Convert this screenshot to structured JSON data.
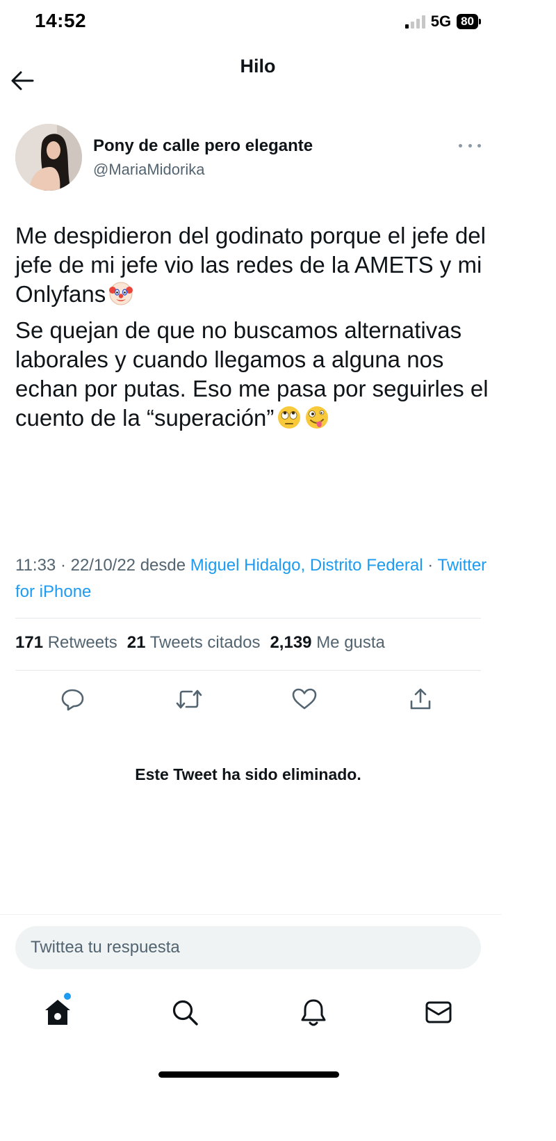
{
  "status_bar": {
    "time": "14:52",
    "network": "5G",
    "battery": "80"
  },
  "header": {
    "title": "Hilo",
    "back_icon": "arrow-left-icon"
  },
  "tweet": {
    "author_name": "Pony de calle pero elegante",
    "author_handle": "@MariaMidorika",
    "paragraph_1": "Me despidieron del godinato porque el jefe del jefe de mi jefe vio las redes de la AMETS y mi Onlyfans",
    "paragraph_1_emoji": "clown-face-emoji",
    "paragraph_2": "Se quejan de que no buscamos alternativas laborales y cuando llegamos a alguna nos echan por putas. Eso me pasa por seguirles el cuento de la “superación”",
    "paragraph_2_emojis": [
      "eye-roll-emoji",
      "zany-face-emoji"
    ],
    "time": "11:33",
    "date": "22/10/22",
    "from_label": "desde",
    "location": "Miguel Hidalgo, Distrito Federal",
    "source": "Twitter for iPhone",
    "retweets_count": "171",
    "retweets_label": "Retweets",
    "quotes_count": "21",
    "quotes_label": "Tweets citados",
    "likes_count": "2,139",
    "likes_label": "Me gusta"
  },
  "actions": [
    "reply-icon",
    "retweet-icon",
    "like-icon",
    "share-icon"
  ],
  "deleted_notice": "Este Tweet ha sido eliminado.",
  "reply": {
    "placeholder": "Twittea tu respuesta"
  },
  "tabs": [
    "home-icon",
    "search-icon",
    "notifications-icon",
    "messages-icon"
  ],
  "colors": {
    "accent": "#1d9bf0",
    "text_primary": "#0f1419",
    "text_secondary": "#536471"
  }
}
